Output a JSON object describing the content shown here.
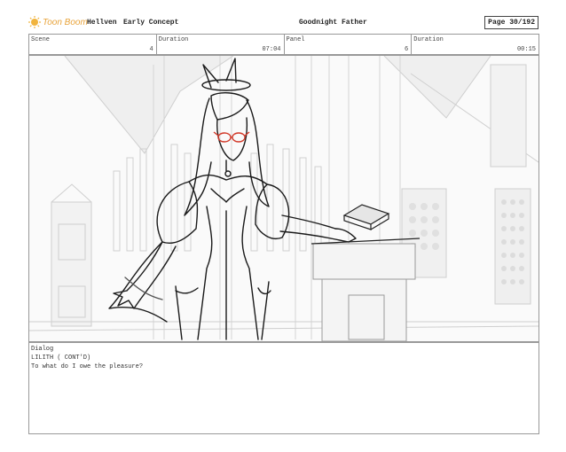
{
  "header": {
    "logo_text": "Toon Boom",
    "project": "Hellven",
    "episode": "Early Concept",
    "title": "Goodnight Father",
    "page_label": "Page",
    "page_value": "30/192"
  },
  "info": {
    "scene_label": "Scene",
    "scene_value": "4",
    "duration_label": "Duration",
    "duration_value": "07:04",
    "panel_label": "Panel",
    "panel_value": "6",
    "panel_duration_label": "Duration",
    "panel_duration_value": "00:15"
  },
  "dialog": {
    "label": "Dialog",
    "lines": [
      "LILITH ( CONT'D)",
      "To what do I owe the pleasure?"
    ]
  },
  "colors": {
    "logo": "#e8a33a",
    "sketch": "#1a1a1a",
    "background_sketch": "#cfcfcf",
    "glasses": "#d23a2a"
  }
}
